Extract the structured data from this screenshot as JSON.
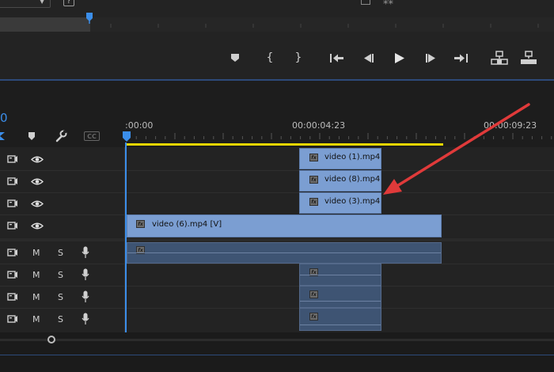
{
  "top": {
    "dropdown_value": "",
    "help_label": "?"
  },
  "timeline": {
    "timecode_partial": "0",
    "ruler": {
      "start": ":00:00",
      "mid": "00:00:04:23",
      "end": "00:00:09:23"
    },
    "cc_label": "CC",
    "video_clips": [
      {
        "label": "video (1).mp4 [",
        "fx": "fx"
      },
      {
        "label": "video (8).mp4 [",
        "fx": "fx"
      },
      {
        "label": "video (3).mp4 [",
        "fx": "fx"
      },
      {
        "label": "video (6).mp4 [V]",
        "fx": "fx"
      }
    ],
    "audio_tracks": [
      {
        "mute": "M",
        "solo": "S"
      },
      {
        "mute": "M",
        "solo": "S"
      },
      {
        "mute": "M",
        "solo": "S"
      },
      {
        "mute": "M",
        "solo": "S"
      }
    ],
    "audio_fx": [
      "fx",
      "fx",
      "fx",
      "fx"
    ]
  },
  "colors": {
    "accent": "#3b8eea",
    "work_area": "#e6d600",
    "video_clip": "#7b9ed2",
    "audio_clip": "#3e5473",
    "annotation_arrow": "#e03a3a"
  },
  "icons": {
    "transport": [
      "add-marker-icon",
      "mark-in-icon",
      "mark-out-icon",
      "go-to-in-icon",
      "step-back-icon",
      "play-icon",
      "step-forward-icon",
      "go-to-out-icon",
      "insert-icon",
      "overwrite-icon"
    ],
    "track_header": [
      "toggle-sync-lock-icon",
      "eye-icon",
      "microphone-icon"
    ]
  }
}
